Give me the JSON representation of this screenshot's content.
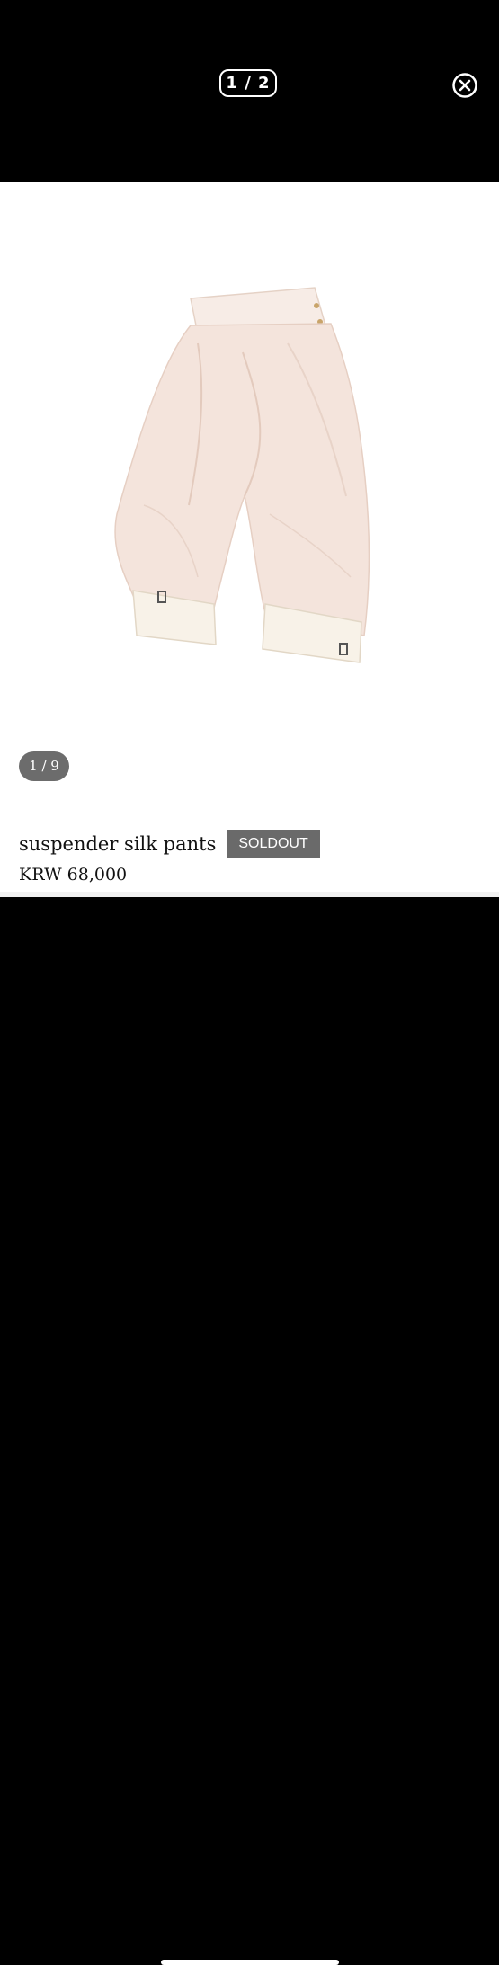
{
  "viewer": {
    "page_counter": "1 / 2",
    "close_icon": "close-circle-icon"
  },
  "product": {
    "image_counter": "1 / 9",
    "title": "suspender silk pants",
    "status_badge": "SOLDOUT",
    "price": "KRW 68,000"
  },
  "colors": {
    "background": "#000000",
    "content_bg": "#ffffff",
    "badge_bg": "#6a6a6a",
    "fabric": "#f4e4dc"
  }
}
